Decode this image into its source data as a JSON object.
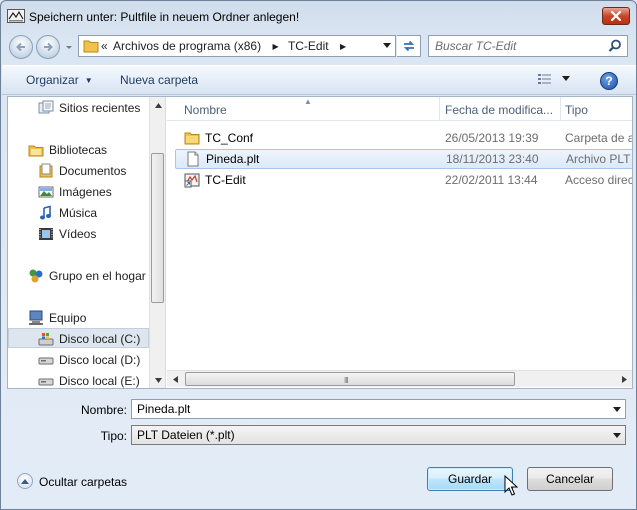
{
  "window": {
    "title": "Speichern unter: Pultfile in neuem Ordner anlegen!"
  },
  "address_bar": {
    "prefix": "«",
    "segments": [
      "Archivos de programa (x86)",
      "TC-Edit"
    ],
    "separator": "▶"
  },
  "search": {
    "placeholder": "Buscar TC-Edit"
  },
  "toolbar": {
    "organize_label": "Organizar",
    "new_folder_label": "Nueva carpeta",
    "help_label": "?"
  },
  "nav_pane": {
    "items": [
      {
        "label": "Sitios recientes",
        "icon": "recent-places-icon"
      },
      {
        "label": "Bibliotecas",
        "icon": "libraries-icon"
      },
      {
        "label": "Documentos",
        "icon": "documents-icon"
      },
      {
        "label": "Imágenes",
        "icon": "pictures-icon"
      },
      {
        "label": "Música",
        "icon": "music-icon"
      },
      {
        "label": "Vídeos",
        "icon": "videos-icon"
      },
      {
        "label": "Grupo en el hogar",
        "icon": "homegroup-icon"
      },
      {
        "label": "Equipo",
        "icon": "computer-icon"
      },
      {
        "label": "Disco local (C:)",
        "icon": "drive-c-icon",
        "selected": true
      },
      {
        "label": "Disco local (D:)",
        "icon": "drive-icon"
      },
      {
        "label": "Disco local (E:)",
        "icon": "drive-icon"
      }
    ]
  },
  "file_list": {
    "columns": [
      "Nombre",
      "Fecha de modifica...",
      "Tipo"
    ],
    "rows": [
      {
        "name": "TC_Conf",
        "date": "26/05/2013 19:39",
        "type": "Carpeta de a",
        "icon": "folder-icon"
      },
      {
        "name": "Pineda.plt",
        "date": "18/11/2013 23:40",
        "type": "Archivo PLT",
        "icon": "file-icon",
        "selected": true
      },
      {
        "name": "TC-Edit",
        "date": "22/02/2011 13:44",
        "type": "Acceso direc",
        "icon": "shortcut-icon"
      }
    ],
    "scroll_grip": "III"
  },
  "form": {
    "name_label": "Nombre:",
    "name_value": "Pineda.plt",
    "type_label": "Tipo:",
    "type_value": "PLT Dateien (*.plt)"
  },
  "footer": {
    "hide_folders_label": "Ocultar carpetas",
    "save_label": "Guardar",
    "cancel_label": "Cancelar"
  },
  "colors": {
    "selection_bg": "#dce9f8",
    "selection_border": "#a8c6ea",
    "title_close": "#c9462c",
    "save_button": "#bee6fd"
  }
}
